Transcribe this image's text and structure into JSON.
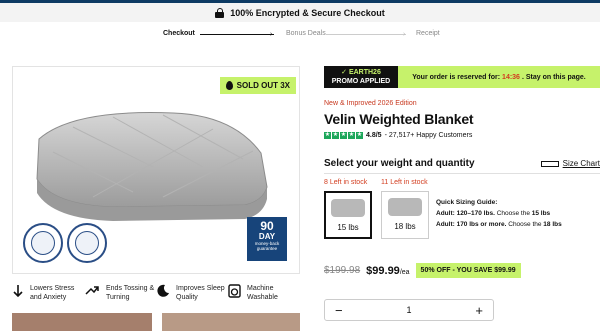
{
  "topbar": {
    "text": "100% Encrypted & Secure Checkout"
  },
  "progress": {
    "steps": [
      "Checkout",
      "Bonus Deals",
      "Receipt"
    ]
  },
  "product_image": {
    "sold_out": "SOLD OUT 3X",
    "seal_left_text": "DOCTOR RECOMMENDED TESTED",
    "seal_right_text": "MACHINE WASHABLE",
    "guarantee": {
      "line1": "90",
      "line2": "DAY",
      "line3": "money-back",
      "line4": "guarantee"
    }
  },
  "features": [
    {
      "icon": "arrow-down-icon",
      "text": "Lowers Stress and Anxiety"
    },
    {
      "icon": "toss-arrows-icon",
      "text": "Ends Tossing & Turning"
    },
    {
      "icon": "moon-icon",
      "text": "Improves Sleep Quality"
    },
    {
      "icon": "washer-icon",
      "text": "Machine Washable"
    }
  ],
  "promo": {
    "code_line1": "✓ EARTH26",
    "code_line2": "PROMO APPLIED",
    "reserve_text": "Your order is reserved for:",
    "timer": "14:36",
    "reserve_suffix": ". Stay on this page."
  },
  "product": {
    "new_tag": "New & Improved 2026 Edition",
    "title": "Velin Weighted Blanket",
    "rating_score": "4.8/5",
    "rating_text": "- 27,517+ Happy Customers"
  },
  "selector": {
    "title": "Select your weight and quantity",
    "size_chart": "Size Chart",
    "options": [
      {
        "stock": "8 Left in stock",
        "label": "15 lbs",
        "selected": true
      },
      {
        "stock": "11 Left in stock",
        "label": "18 lbs",
        "selected": false
      }
    ],
    "guide_title": "Quick Sizing Guide:",
    "guide_line1_a": "Adult: 120–170 lbs.",
    "guide_line1_b": " Choose the ",
    "guide_line1_c": "15 lbs",
    "guide_line2_a": "Adult: 170 lbs or more.",
    "guide_line2_b": " Choose the ",
    "guide_line2_c": "18 lbs"
  },
  "pricing": {
    "old_price": "$199.98",
    "new_price": "$99.99",
    "unit": "/ea",
    "save_badge": "50% OFF - YOU SAVE $99.99"
  },
  "quantity": {
    "minus": "−",
    "value": "1",
    "plus": "+"
  },
  "colors": {
    "accent_green": "#c6f26b",
    "brand_blue": "#17447a",
    "alert_red": "#d23c1e",
    "star_green": "#1da65a"
  }
}
